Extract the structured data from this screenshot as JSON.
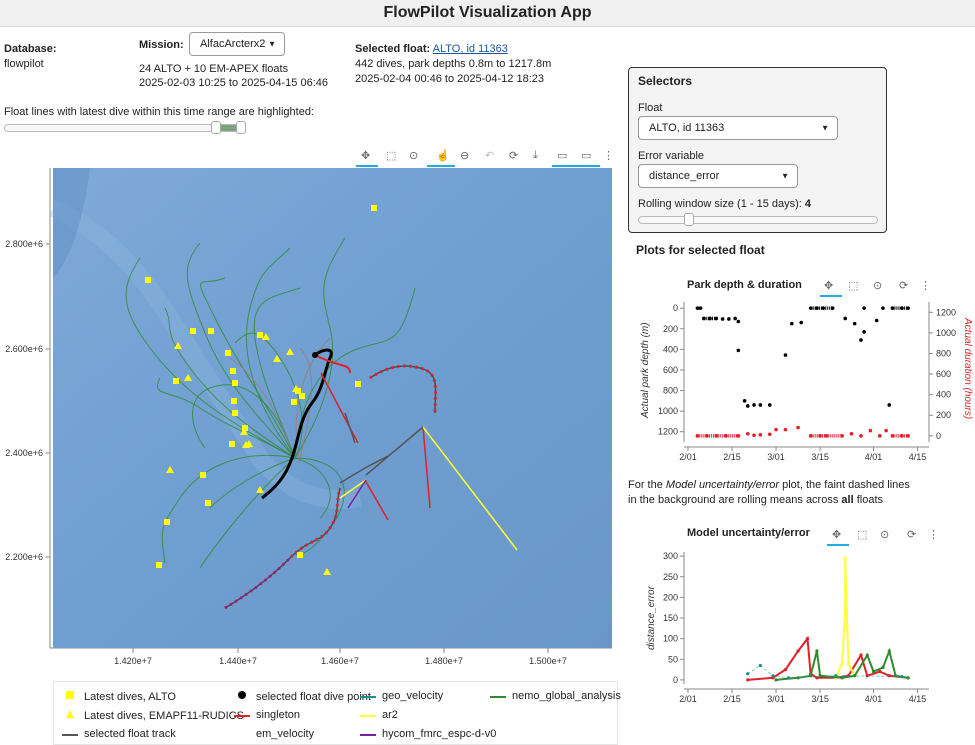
{
  "app": {
    "title": "FlowPilot Visualization App"
  },
  "database": {
    "label": "Database:",
    "value": "flowpilot"
  },
  "mission": {
    "label": "Mission:",
    "selected": "AlfacArcterx2",
    "floats_summary": "24 ALTO + 10 EM-APEX floats",
    "date_range": "2025-02-03 10:25 to 2025-04-15 06:46"
  },
  "selected_float": {
    "label": "Selected float:",
    "link": "ALTO, id 11363",
    "dives": "442 dives, park depths 0.8m to 1217.8m",
    "date_range": "2025-02-04 00:46 to 2025-04-12 18:23"
  },
  "time_range": {
    "label": "Float lines with latest dive within this time range are highlighted:"
  },
  "selectors": {
    "title": "Selectors",
    "float_label": "Float",
    "float_value": "ALTO, id 11363",
    "error_label": "Error variable",
    "error_value": "distance_error",
    "rolling_label": "Rolling window size (1 - 15 days):",
    "rolling_value": "4"
  },
  "plots": {
    "header": "Plots for selected float",
    "note_prefix": "For the",
    "note_italic": "Model uncertainty/error",
    "note_mid": "plot, the faint dashed lines",
    "note_line2_prefix": "in the background are rolling means across",
    "note_bold": "all",
    "note_suffix": "floats"
  },
  "icons": [
    "pan-icon",
    "box-zoom-icon",
    "wheel-zoom-icon",
    "tap-icon",
    "zoom-out-icon",
    "undo-icon",
    "reset-icon",
    "save-icon",
    "hover-icon",
    "hover-icon",
    "more-icon"
  ],
  "map": {
    "x_ticks": [
      "1.420e+7",
      "1.440e+7",
      "1.460e+7",
      "1.480e+7",
      "1.500e+7"
    ],
    "y_ticks": [
      "2.800e+6",
      "2.600e+6",
      "2.400e+6",
      "2.200e+6"
    ],
    "colors": {
      "alto": "#ffff00",
      "selected_track": "#000000",
      "singleton": "#e0202a",
      "geo_velocity": "#1a8f8f",
      "ar2": "#ffff33",
      "nemo": "#2e8b2e",
      "hycom": "#7b1fa2",
      "ocean": "#6f9ed0"
    }
  },
  "legend": {
    "items": [
      {
        "label": "Latest dives, ALTO",
        "icon": "square-marker-icon"
      },
      {
        "label": "Latest dives, EMAPF11-RUDICS",
        "icon": "triangle-marker-icon"
      },
      {
        "label": "selected float track",
        "icon": "line-icon"
      },
      {
        "label": "selected float dive point",
        "icon": "circle-marker-icon"
      },
      {
        "label": "singleton",
        "icon": "line-icon"
      },
      {
        "label": "em_velocity",
        "icon": "line-icon"
      },
      {
        "label": "geo_velocity",
        "icon": "line-icon"
      },
      {
        "label": "ar2",
        "icon": "line-icon"
      },
      {
        "label": "hycom_fmrc_espc-d-v0",
        "icon": "line-icon"
      },
      {
        "label": "nemo_global_analysis",
        "icon": "line-icon"
      }
    ]
  },
  "chart_data": [
    {
      "type": "scatter",
      "title": "Park depth & duration",
      "ylabel": "Actual park depth (m)",
      "y2label": "Actual duration (hours)",
      "x_ticks": [
        "2/01",
        "2/15",
        "3/01",
        "3/15",
        "4/01",
        "4/15"
      ],
      "y_ticks": [
        "0",
        "200",
        "400",
        "600",
        "800",
        "1000",
        "1200"
      ],
      "y2_ticks": [
        "0",
        "200",
        "400",
        "600",
        "800",
        "1000",
        "1200"
      ],
      "ylim": [
        1300,
        -60
      ],
      "y2lim": [
        -60,
        1300
      ],
      "series": [
        {
          "name": "park depth",
          "color": "#000000",
          "points": [
            {
              "x": "2025-02-04",
              "y": 0
            },
            {
              "x": "2025-02-05",
              "y": 0
            },
            {
              "x": "2025-02-06",
              "y": 100
            },
            {
              "x": "2025-02-08",
              "y": 100
            },
            {
              "x": "2025-02-10",
              "y": 100
            },
            {
              "x": "2025-02-12",
              "y": 105
            },
            {
              "x": "2025-02-14",
              "y": 105
            },
            {
              "x": "2025-02-16",
              "y": 100
            },
            {
              "x": "2025-02-17",
              "y": 130
            },
            {
              "x": "2025-02-17",
              "y": 410
            },
            {
              "x": "2025-02-19",
              "y": 900
            },
            {
              "x": "2025-02-20",
              "y": 950
            },
            {
              "x": "2025-02-22",
              "y": 940
            },
            {
              "x": "2025-02-24",
              "y": 940
            },
            {
              "x": "2025-02-27",
              "y": 940
            },
            {
              "x": "2025-03-04",
              "y": 455
            },
            {
              "x": "2025-03-06",
              "y": 150
            },
            {
              "x": "2025-03-09",
              "y": 140
            },
            {
              "x": "2025-03-12",
              "y": 0
            },
            {
              "x": "2025-03-14",
              "y": 0
            },
            {
              "x": "2025-03-16",
              "y": 0
            },
            {
              "x": "2025-03-19",
              "y": 0
            },
            {
              "x": "2025-03-23",
              "y": 100
            },
            {
              "x": "2025-03-26",
              "y": 150
            },
            {
              "x": "2025-03-28",
              "y": 310
            },
            {
              "x": "2025-03-29",
              "y": 230
            },
            {
              "x": "2025-03-29",
              "y": 0
            },
            {
              "x": "2025-04-02",
              "y": 120
            },
            {
              "x": "2025-04-04",
              "y": 0
            },
            {
              "x": "2025-04-06",
              "y": 940
            },
            {
              "x": "2025-04-07",
              "y": 0
            },
            {
              "x": "2025-04-10",
              "y": 0
            },
            {
              "x": "2025-04-12",
              "y": 0
            }
          ]
        },
        {
          "name": "duration",
          "color": "#e0202a",
          "points": [
            {
              "x": "2025-02-04",
              "y": 0
            },
            {
              "x": "2025-02-07",
              "y": 0
            },
            {
              "x": "2025-02-10",
              "y": 0
            },
            {
              "x": "2025-02-13",
              "y": 0
            },
            {
              "x": "2025-02-17",
              "y": 0
            },
            {
              "x": "2025-02-20",
              "y": 20
            },
            {
              "x": "2025-02-22",
              "y": 5
            },
            {
              "x": "2025-02-24",
              "y": 10
            },
            {
              "x": "2025-02-27",
              "y": 15
            },
            {
              "x": "2025-03-01",
              "y": 60
            },
            {
              "x": "2025-03-04",
              "y": 60
            },
            {
              "x": "2025-03-08",
              "y": 80
            },
            {
              "x": "2025-03-12",
              "y": 0
            },
            {
              "x": "2025-03-15",
              "y": 0
            },
            {
              "x": "2025-03-17",
              "y": 0
            },
            {
              "x": "2025-03-22",
              "y": 0
            },
            {
              "x": "2025-03-25",
              "y": 20
            },
            {
              "x": "2025-03-28",
              "y": 0
            },
            {
              "x": "2025-03-31",
              "y": 50
            },
            {
              "x": "2025-04-03",
              "y": 0
            },
            {
              "x": "2025-04-05",
              "y": 50
            },
            {
              "x": "2025-04-07",
              "y": 0
            },
            {
              "x": "2025-04-10",
              "y": 0
            },
            {
              "x": "2025-04-12",
              "y": 0
            }
          ]
        }
      ]
    },
    {
      "type": "line",
      "title": "Model uncertainty/error",
      "ylabel": "distance_error",
      "x_ticks": [
        "2/01",
        "2/15",
        "3/01",
        "3/15",
        "4/01",
        "4/15"
      ],
      "y_ticks": [
        "0",
        "50",
        "100",
        "150",
        "200",
        "250",
        "300"
      ],
      "ylim": [
        -10,
        310
      ],
      "series": [
        {
          "name": "singleton",
          "color": "#e0202a",
          "points": [
            [
              "2025-02-20",
              0
            ],
            [
              "2025-02-28",
              5
            ],
            [
              "2025-03-04",
              25
            ],
            [
              "2025-03-08",
              70
            ],
            [
              "2025-03-11",
              100
            ],
            [
              "2025-03-12",
              15
            ],
            [
              "2025-03-14",
              5
            ],
            [
              "2025-03-20",
              5
            ],
            [
              "2025-03-24",
              10
            ],
            [
              "2025-03-28",
              60
            ],
            [
              "2025-03-30",
              10
            ],
            [
              "2025-04-03",
              20
            ],
            [
              "2025-04-06",
              10
            ],
            [
              "2025-04-12",
              5
            ]
          ]
        },
        {
          "name": "ar2",
          "color": "#ffff33",
          "points": [
            [
              "2025-03-20",
              5
            ],
            [
              "2025-03-22",
              40
            ],
            [
              "2025-03-23",
              170
            ],
            [
              "2025-03-23",
              295
            ],
            [
              "2025-03-24",
              40
            ],
            [
              "2025-03-26",
              10
            ]
          ]
        },
        {
          "name": "nemo_global_analysis",
          "color": "#2e8b2e",
          "points": [
            [
              "2025-03-01",
              0
            ],
            [
              "2025-03-08",
              5
            ],
            [
              "2025-03-12",
              10
            ],
            [
              "2025-03-14",
              70
            ],
            [
              "2025-03-15",
              10
            ],
            [
              "2025-03-22",
              5
            ],
            [
              "2025-03-26",
              10
            ],
            [
              "2025-03-30",
              60
            ],
            [
              "2025-04-01",
              20
            ],
            [
              "2025-04-04",
              30
            ],
            [
              "2025-04-06",
              70
            ],
            [
              "2025-04-08",
              10
            ],
            [
              "2025-04-12",
              5
            ]
          ]
        },
        {
          "name": "geo_velocity",
          "color": "#1a8f8f",
          "points": [
            [
              "2025-02-20",
              15
            ],
            [
              "2025-02-24",
              35
            ],
            [
              "2025-02-28",
              10
            ],
            [
              "2025-03-05",
              5
            ],
            [
              "2025-03-20",
              10
            ],
            [
              "2025-04-10",
              8
            ]
          ]
        }
      ]
    }
  ]
}
